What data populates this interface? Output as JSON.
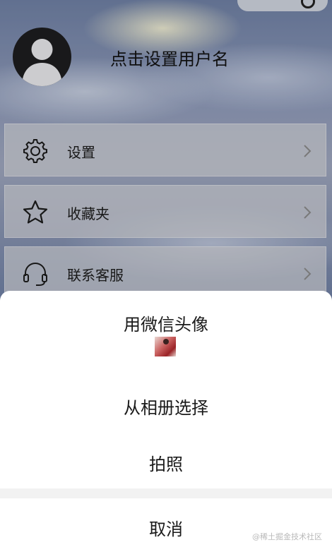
{
  "profile": {
    "username": "点击设置用户名"
  },
  "menu": {
    "items": [
      {
        "label": "设置",
        "icon": "gear-icon"
      },
      {
        "label": "收藏夹",
        "icon": "star-icon"
      },
      {
        "label": "联系客服",
        "icon": "headset-icon"
      }
    ]
  },
  "action_sheet": {
    "wechat_avatar_label": "用微信头像",
    "album_label": "从相册选择",
    "camera_label": "拍照",
    "cancel_label": "取消"
  },
  "watermark": "@稀土掘金技术社区",
  "colors": {
    "sheet_background": "#ffffff",
    "text": "#1a1a1a",
    "page_tint": "#7e8fb0"
  }
}
